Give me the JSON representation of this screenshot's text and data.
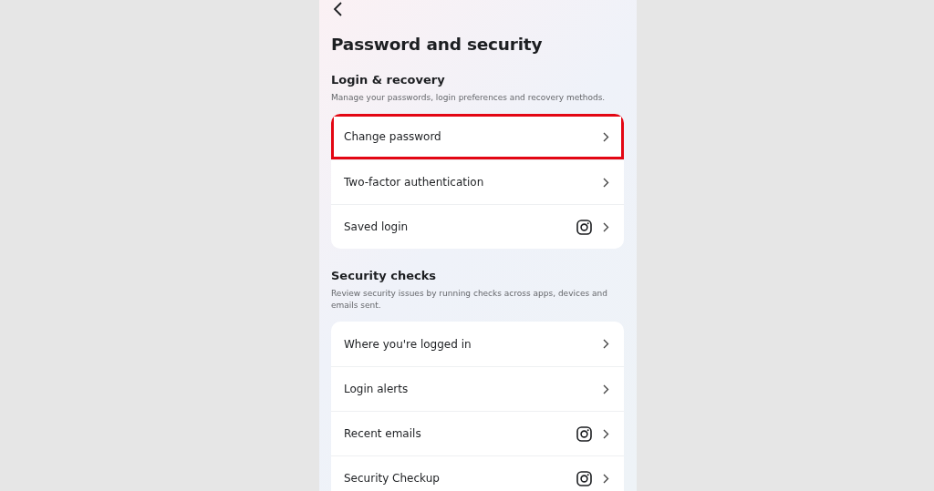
{
  "title": "Password and security",
  "sections": [
    {
      "heading": "Login & recovery",
      "description": "Manage your passwords, login preferences and recovery methods.",
      "items": [
        {
          "label": "Change password",
          "app_icon": false,
          "highlighted": true
        },
        {
          "label": "Two-factor authentication",
          "app_icon": false,
          "highlighted": false
        },
        {
          "label": "Saved login",
          "app_icon": true,
          "highlighted": false
        }
      ]
    },
    {
      "heading": "Security checks",
      "description": "Review security issues by running checks across apps, devices and emails sent.",
      "items": [
        {
          "label": "Where you're logged in",
          "app_icon": false,
          "highlighted": false
        },
        {
          "label": "Login alerts",
          "app_icon": false,
          "highlighted": false
        },
        {
          "label": "Recent emails",
          "app_icon": true,
          "highlighted": false
        },
        {
          "label": "Security Checkup",
          "app_icon": true,
          "highlighted": false
        }
      ]
    }
  ]
}
